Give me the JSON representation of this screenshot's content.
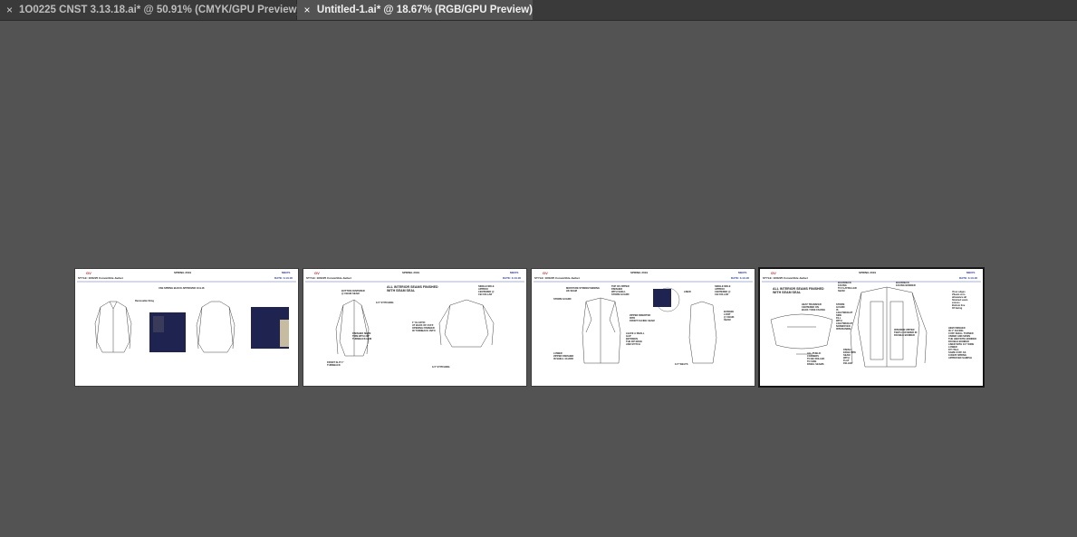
{
  "tabs": [
    {
      "close": "×",
      "label": "1O0225 CNST 3.13.18.ai* @ 50.91% (CMYK/GPU Preview)",
      "active": false
    },
    {
      "close": "×",
      "label": "Untitled-1.ai* @ 18.67% (RGB/GPU Preview)",
      "active": true
    }
  ],
  "artboards": [
    {
      "season": "SPRING 2019",
      "division": "MEN'S",
      "style": "STYLE: 1O0225 Convertible Jacket",
      "date": "DATE: 3.13.18",
      "notes": [
        "USE SPRING BLOCK APPROVED 10.9.18",
        "Removable Sling"
      ]
    },
    {
      "season": "SPRING 2019",
      "division": "MEN'S",
      "style": "STYLE: 1O0225 Convertible Jacket",
      "date": "DATE: 3.13.18",
      "notes": [
        "ALL INTERIOR SEAMS FINISHED\nWITH SEAM SEAL",
        "BUTTON CENTERED\n@ CB/HK SEAM",
        "1/4\" STITCHING",
        "FINISHED SEAM\nTRIM WITH 3/8\"\nTURNBACK HEM",
        "FRONT SLIT 1\"\nTURNBACK",
        "1\" ELASTIC\nAT BACK OF CUFF\nOPENING FINISHED\nIN TURNBACK 1NTO",
        "1/4\" STITCHING",
        "SINGLE NDLE\nAPPROX\nCENTERED @\nCB COLLAR"
      ]
    },
    {
      "season": "SPRING 2019",
      "division": "MEN'S",
      "style": "STYLE: 1O0225 Convertible Jacket",
      "date": "DATE: 3.13.18",
      "notes": [
        "MOISTURE STRENGTHENING\nHK SEAM",
        "STORM GUARD",
        "TOP OF ZIPPER\nFINISHED\nWITH SHELL\nSTORM GUARD",
        "ZIPPER INSERTED\nINTO\nFRONT FACING SEAM",
        "LEAVE A SMALL\nGAP\nBETWEEN\nTHE ZIP EDGE\nAND STITCH",
        "LOWER\nZIPPER FINISHED\nIN SHELL GUARD",
        "LINED",
        "1/4\" WELTS",
        "SINGLE NDLE\nAPPROX\nCENTERED @\nCB COLLAR",
        "BUNGEE\nLOOP\n@ CB/HK\nSEAM"
      ]
    },
    {
      "season": "SPRING 2019",
      "division": "MEN'S",
      "style": "STYLE: 1O0225 Convertible Jacket",
      "date": "DATE: 3.13.18",
      "notes": [
        "ALL INTERIOR SEAMS FINISHED\nWITH SEAM SEAL",
        "HEAT TRANSFER\nCENTERED ON\nBACK YOKE FACING",
        "BACKNECK\nFACING\nTO FLATFELLED\nSEAM",
        "BACKNECK\nFACING BONDED",
        "STORM\nGUARD\nIS\nLIGHTWEIGHT\nSIDE\nFILL\nWITH\nLIGHTWEIGHT\nNONWOVEN\nINTERLINING",
        "INTERIOR ZIPPER\nTEETH COVERED IN\nDOUBLE BONDED",
        "ALL PUBLIC\nCORNERS\nTO BE ROLLED\nTO SIDE\nPANEL SEAMS",
        "FINISH\nEDGE PIPE\nSEAM\nWITH\nFLAT\nFELLED",
        "Visor edges\n#Seam zero\nallowance all\nfinished seam\nexcess\nBottom line\nOf facing",
        "HEM FINISHED\nIN 1\" FACING\nCUFF SHELL TURNED\nUNDER AND SEWN\nTHE HEM WITH BONDED\nDOUBLE BONDED\nLINED WITH 1/4\" WIDE\nLOWER\nFIT ITALL\nSAME CUFF AS\n1O0225 SPRING\nAPPROVED SAMPLE"
      ]
    }
  ]
}
